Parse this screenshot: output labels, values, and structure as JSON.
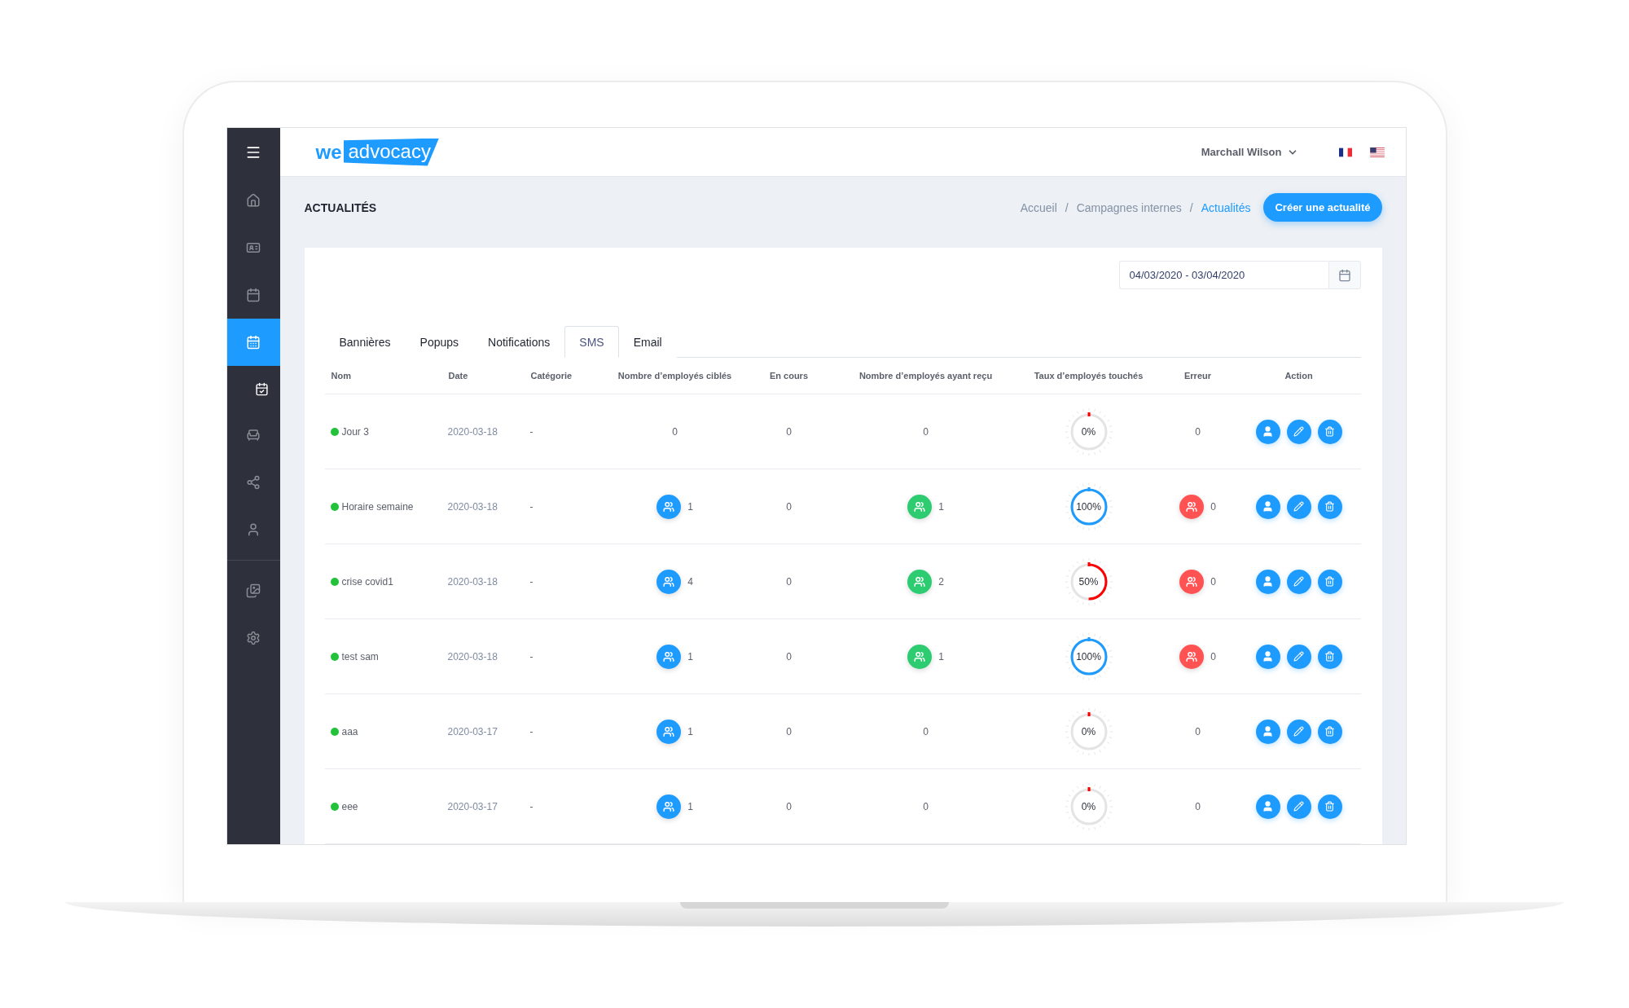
{
  "logo": {
    "prefix": "we",
    "name": "advocacy"
  },
  "user": {
    "name": "Marchall Wilson"
  },
  "sidebar": {
    "items": [
      {
        "selected": false
      },
      {
        "selected": false
      },
      {
        "selected": false
      },
      {
        "selected": true,
        "children": [
          {
            "selected": true
          }
        ]
      },
      {
        "selected": false
      },
      {
        "selected": false
      },
      {
        "selected": false
      }
    ],
    "bottom_items": [
      {
        "selected": false
      },
      {
        "selected": false
      }
    ]
  },
  "page": {
    "title": "ACTUALITÉS",
    "breadcrumb": {
      "separator": "/",
      "items": [
        {
          "label": "Accueil",
          "selected": false
        },
        {
          "label": "Campagnes internes",
          "selected": false
        },
        {
          "label": "Actualités",
          "selected": true
        }
      ]
    },
    "create_button": "Créer une actualité"
  },
  "date_range": {
    "value": "04/03/2020 - 03/04/2020"
  },
  "tabs": [
    {
      "label": "Bannières",
      "selected": false
    },
    {
      "label": "Popups",
      "selected": false
    },
    {
      "label": "Notifications",
      "selected": false
    },
    {
      "label": "SMS",
      "selected": true
    },
    {
      "label": "Email",
      "selected": false
    }
  ],
  "table": {
    "columns": [
      "Nom",
      "Date",
      "Catégorie",
      "Nombre d’employés ciblés",
      "En cours",
      "Nombre d’employés ayant reçu",
      "Taux d’employés touchés",
      "Erreur",
      "Action"
    ],
    "rows": [
      {
        "name": "Jour 3",
        "active": true,
        "date": "2020-03-18",
        "category": "-",
        "targeted": {
          "value": "0",
          "badge": false
        },
        "in_progress": "0",
        "received": {
          "value": "0",
          "badge": false
        },
        "rate": {
          "text": "0%",
          "level": 0,
          "color": "#ff0000"
        },
        "error": {
          "value": "0",
          "badge": false
        }
      },
      {
        "name": "Horaire semaine",
        "active": true,
        "date": "2020-03-18",
        "category": "-",
        "targeted": {
          "value": "1",
          "badge": true
        },
        "in_progress": "0",
        "received": {
          "value": "1",
          "badge": true
        },
        "rate": {
          "text": "100%",
          "level": 1,
          "color": "#1e9bff"
        },
        "error": {
          "value": "0",
          "badge": true
        }
      },
      {
        "name": "crise covid1",
        "active": true,
        "date": "2020-03-18",
        "category": "-",
        "targeted": {
          "value": "4",
          "badge": true
        },
        "in_progress": "0",
        "received": {
          "value": "2",
          "badge": true
        },
        "rate": {
          "text": "50%",
          "level": 0.5,
          "color": "#ff0000"
        },
        "error": {
          "value": "0",
          "badge": true
        }
      },
      {
        "name": "test sam",
        "active": true,
        "date": "2020-03-18",
        "category": "-",
        "targeted": {
          "value": "1",
          "badge": true
        },
        "in_progress": "0",
        "received": {
          "value": "1",
          "badge": true
        },
        "rate": {
          "text": "100%",
          "level": 1,
          "color": "#1e9bff"
        },
        "error": {
          "value": "0",
          "badge": true
        }
      },
      {
        "name": "aaa",
        "active": true,
        "date": "2020-03-17",
        "category": "-",
        "targeted": {
          "value": "1",
          "badge": true
        },
        "in_progress": "0",
        "received": {
          "value": "0",
          "badge": false
        },
        "rate": {
          "text": "0%",
          "level": 0,
          "color": "#ff0000"
        },
        "error": {
          "value": "0",
          "badge": false
        }
      },
      {
        "name": "eee",
        "active": true,
        "date": "2020-03-17",
        "category": "-",
        "targeted": {
          "value": "1",
          "badge": true
        },
        "in_progress": "0",
        "received": {
          "value": "0",
          "badge": false
        },
        "rate": {
          "text": "0%",
          "level": 0,
          "color": "#ff0000"
        },
        "error": {
          "value": "0",
          "badge": false
        }
      }
    ]
  }
}
